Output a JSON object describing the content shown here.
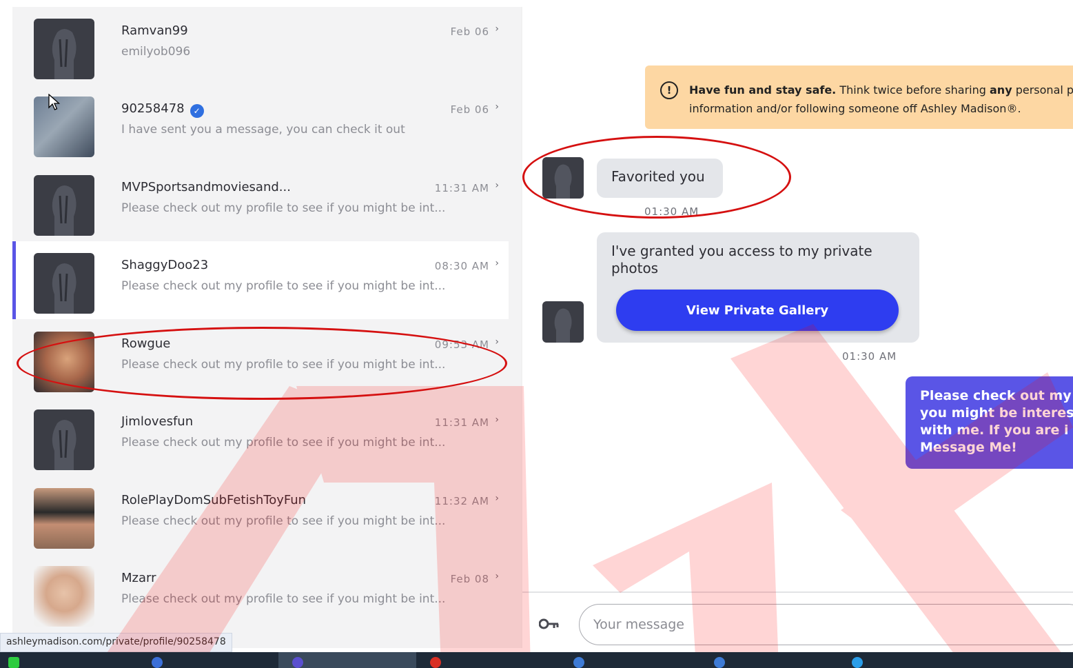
{
  "conversations": [
    {
      "name": "Ramvan99",
      "preview": "emilyob096",
      "time": "Feb 06",
      "verified": false,
      "avatar": "silhouette"
    },
    {
      "name": "90258478",
      "preview": "I have sent you a message, you can check it out",
      "time": "Feb 06",
      "verified": true,
      "avatar": "photo"
    },
    {
      "name": "MVPSportsandmoviesand...",
      "preview": "Please check out my profile to see if you might be int...",
      "time": "11:31 AM",
      "verified": false,
      "avatar": "silhouette"
    },
    {
      "name": "ShaggyDoo23",
      "preview": "Please check out my profile to see if you might be int...",
      "time": "08:30 AM",
      "verified": false,
      "avatar": "silhouette"
    },
    {
      "name": "Rowgue",
      "preview": "Please check out my profile to see if you might be int...",
      "time": "09:53 AM",
      "verified": false,
      "avatar": "photo"
    },
    {
      "name": "Jimlovesfun",
      "preview": "Please check out my profile to see if you might be int...",
      "time": "11:31 AM",
      "verified": false,
      "avatar": "silhouette"
    },
    {
      "name": "RolePlayDomSubFetishToyFun",
      "preview": "Please check out my profile to see if you might be int...",
      "time": "11:32 AM",
      "verified": false,
      "avatar": "photo"
    },
    {
      "name": "Mzarr",
      "preview": "Please check out my profile to see if you might be int...",
      "time": "Feb 08",
      "verified": false,
      "avatar": "photo"
    }
  ],
  "status_bar": {
    "url": "ashleymadison.com/private/profile/90258478"
  },
  "safety_notice": {
    "bold_lead": "Have fun and stay safe.",
    "text_a": "Think twice before sharing",
    "bold_word": "any",
    "text_b": "personal pict",
    "line2": "information and/or following someone off Ashley Madison®."
  },
  "messages": {
    "favorited": {
      "text": "Favorited you",
      "time": "01:30 AM"
    },
    "private_access": {
      "text_line1": "I've granted you access to my private",
      "text_line2": "photos",
      "button": "View Private Gallery",
      "time": "01:30 AM"
    },
    "outgoing": {
      "lines": [
        "Please check out my",
        "you might be interes",
        "with me. If you are i",
        "Message Me!"
      ]
    }
  },
  "composer": {
    "placeholder": "Your message"
  },
  "colors": {
    "accent": "#5a55e6",
    "button": "#2e3df0",
    "annotation": "#d51010",
    "safety_bg": "#fdd7a3"
  }
}
